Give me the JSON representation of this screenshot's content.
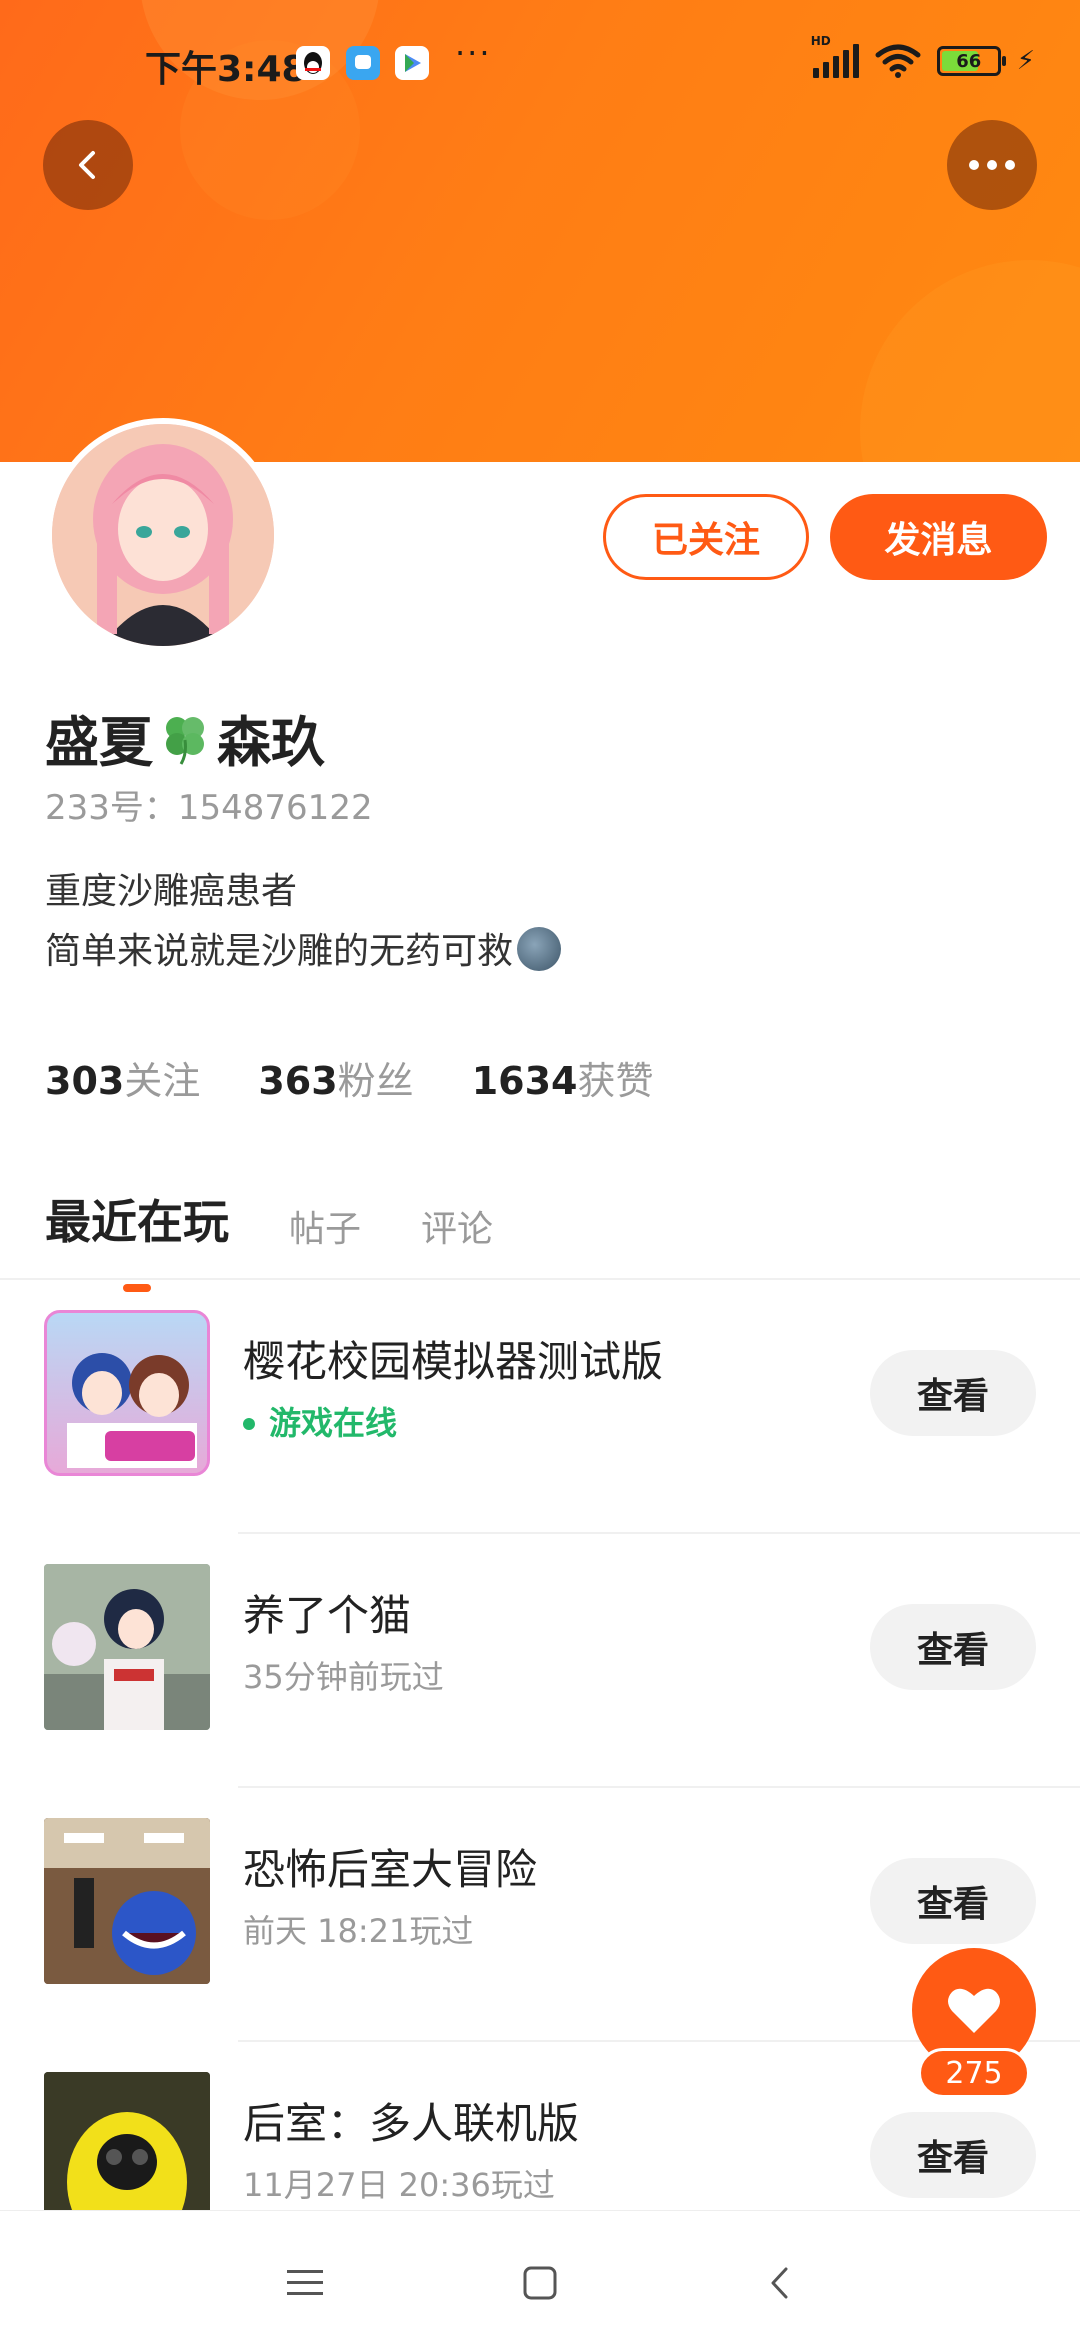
{
  "status_bar": {
    "time": "下午3:48",
    "dots": "···",
    "battery": "66",
    "signal_label": "HD",
    "app_icons": [
      "qq-icon",
      "chat-app-icon",
      "play-store-icon"
    ]
  },
  "profile": {
    "nickname_part1": "盛夏",
    "nickname_part2": "森玖",
    "uid": "233号：154876122",
    "bio_line1": "重度沙雕癌患者",
    "bio_line2": "简单来说就是沙雕的无药可救",
    "follow_button": "已关注",
    "message_button": "发消息"
  },
  "stats": [
    {
      "num": "303",
      "label": "关注"
    },
    {
      "num": "363",
      "label": "粉丝"
    },
    {
      "num": "1634",
      "label": "获赞"
    }
  ],
  "tabs": [
    {
      "label": "最近在玩",
      "active": true
    },
    {
      "label": "帖子",
      "active": false
    },
    {
      "label": "评论",
      "active": false
    }
  ],
  "games": [
    {
      "title": "樱花校园模拟器测试版",
      "status": "游戏在线",
      "online": true,
      "button": "查看"
    },
    {
      "title": "养了个猫",
      "status": "35分钟前玩过",
      "online": false,
      "button": "查看"
    },
    {
      "title": "恐怖后室大冒险",
      "status": "前天 18:21玩过",
      "online": false,
      "button": "查看"
    },
    {
      "title": "后室：多人联机版",
      "status": "11月27日 20:36玩过",
      "online": false,
      "button": "查看"
    }
  ],
  "like": {
    "count": "275"
  },
  "colors": {
    "accent": "#ff5a14",
    "online": "#22b86a",
    "banner": "#ff7d15"
  }
}
